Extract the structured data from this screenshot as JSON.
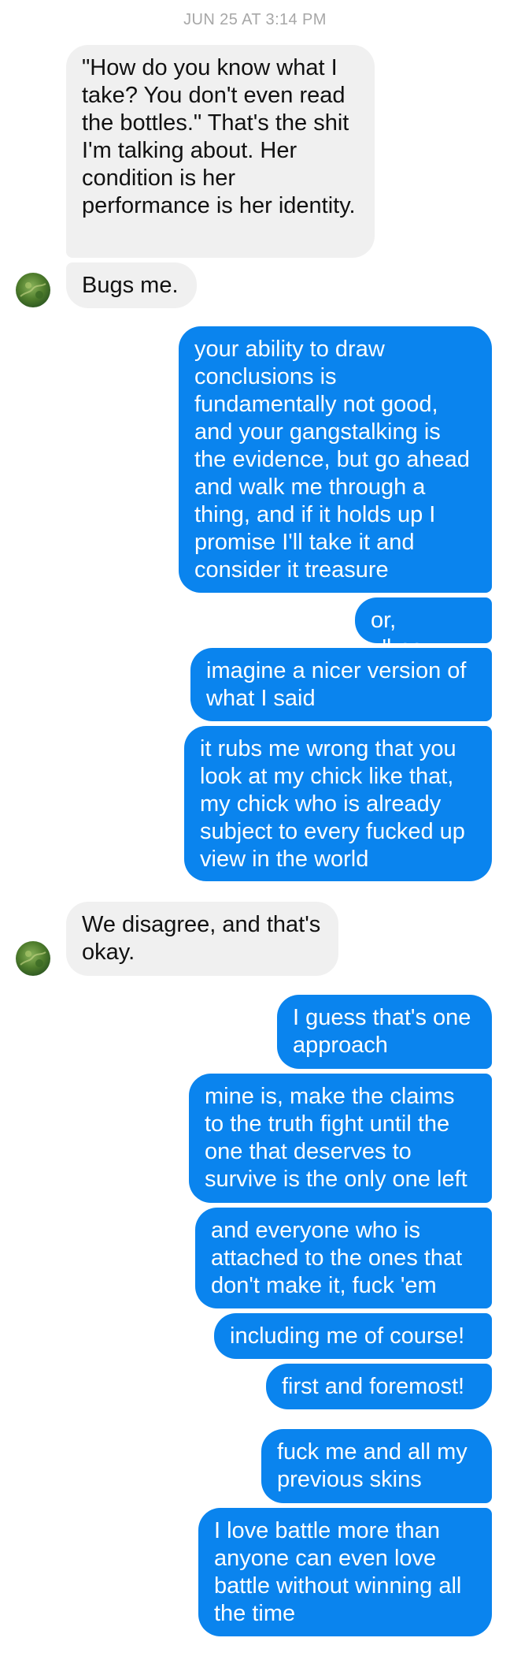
{
  "conversation": {
    "timestamp": "JUN 25 AT 3:14 PM",
    "messages": [
      {
        "from": "them",
        "text": "\"How do you know what I take? You don't even read the bottles.\" That's the shit I'm talking about. Her condition is her performance is her identity."
      },
      {
        "from": "them",
        "text": "Bugs me."
      },
      {
        "from": "me",
        "text": "your ability to draw conclusions is fundamentally not good, and your gangstalking is the evidence, but go ahead and walk me through a thing, and if it holds up I promise I'll take it and consider it treasure"
      },
      {
        "from": "me",
        "text": "or, y'know,"
      },
      {
        "from": "me",
        "text": "imagine a nicer version of what I said"
      },
      {
        "from": "me",
        "text": "it rubs me wrong that you look at my chick like that, my chick who is already subject to every fucked up view in the world"
      },
      {
        "from": "them",
        "text": "We disagree, and that's okay."
      },
      {
        "from": "me",
        "text": "I guess that's one approach"
      },
      {
        "from": "me",
        "text": "mine is, make the claims to the truth fight until the one that deserves to survive is the only one left"
      },
      {
        "from": "me",
        "text": "and everyone who is attached to the ones that don't make it, fuck 'em"
      },
      {
        "from": "me",
        "text": "including me of course!"
      },
      {
        "from": "me",
        "text": "first and foremost!"
      },
      {
        "from": "me",
        "text": "fuck me and all my previous skins"
      },
      {
        "from": "me",
        "text": "I love battle more than anyone can even love battle without winning all the time"
      }
    ]
  },
  "colors": {
    "outgoing_bubble": "#0a84ee",
    "incoming_bubble": "#f0f0f0",
    "timestamp": "#a7a7a7"
  },
  "icons": {
    "avatar": "contact-avatar-photo"
  }
}
